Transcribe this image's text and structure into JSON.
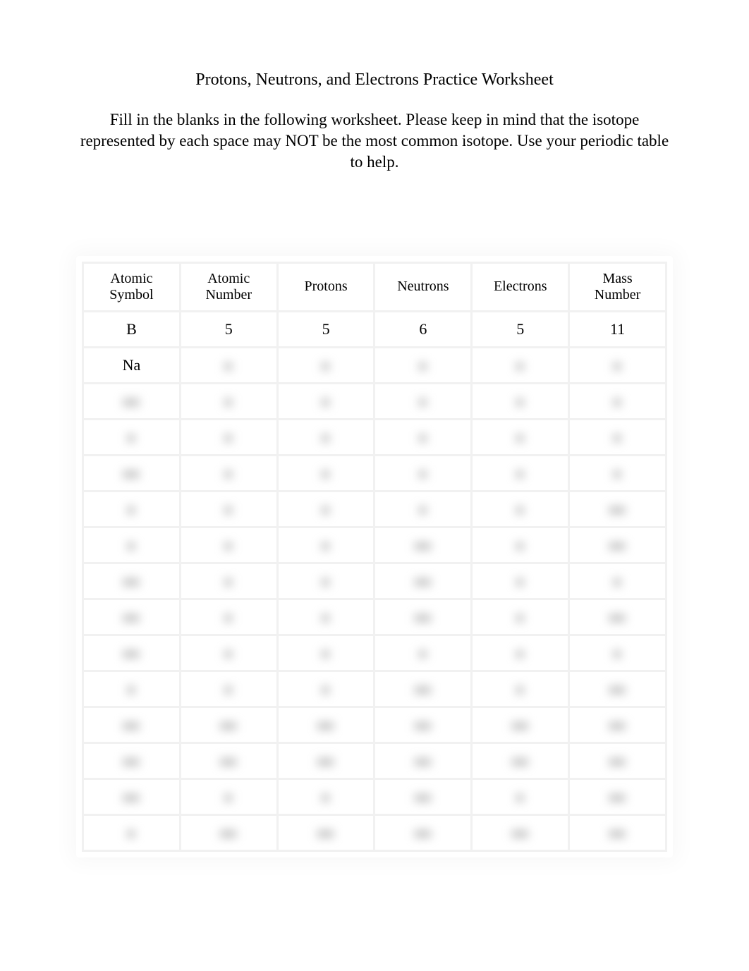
{
  "title": "Protons, Neutrons, and Electrons Practice Worksheet",
  "instructions": "Fill in the blanks in the following worksheet. Please keep in mind that the isotope represented by each space may NOT be the most common isotope. Use your periodic table to help​.",
  "headers": {
    "col0": "Atomic\nSymbol",
    "col1": "Atomic\nNumber",
    "col2": "Protons",
    "col3": "Neutrons",
    "col4": "Electrons",
    "col5": "Mass\nNumber"
  },
  "rows": [
    {
      "c0": {
        "text": "B",
        "blur": false
      },
      "c1": {
        "text": "5",
        "blur": false
      },
      "c2": {
        "text": "5",
        "blur": false
      },
      "c3": {
        "text": "6",
        "blur": false
      },
      "c4": {
        "text": "5",
        "blur": false
      },
      "c5": {
        "text": "11",
        "blur": false
      }
    },
    {
      "c0": {
        "text": "Na",
        "blur": false
      },
      "c1": {
        "text": "■",
        "blur": true
      },
      "c2": {
        "text": "■",
        "blur": true
      },
      "c3": {
        "text": "■",
        "blur": true
      },
      "c4": {
        "text": "■",
        "blur": true
      },
      "c5": {
        "text": "■",
        "blur": true
      }
    },
    {
      "c0": {
        "text": "■■",
        "blur": true
      },
      "c1": {
        "text": "■",
        "blur": true
      },
      "c2": {
        "text": "■",
        "blur": true
      },
      "c3": {
        "text": "■",
        "blur": true
      },
      "c4": {
        "text": "■",
        "blur": true
      },
      "c5": {
        "text": "■",
        "blur": true
      }
    },
    {
      "c0": {
        "text": "■",
        "blur": true
      },
      "c1": {
        "text": "■",
        "blur": true
      },
      "c2": {
        "text": "■",
        "blur": true
      },
      "c3": {
        "text": "■",
        "blur": true
      },
      "c4": {
        "text": "■",
        "blur": true
      },
      "c5": {
        "text": "■",
        "blur": true
      }
    },
    {
      "c0": {
        "text": "■■",
        "blur": true
      },
      "c1": {
        "text": "■",
        "blur": true
      },
      "c2": {
        "text": "■",
        "blur": true
      },
      "c3": {
        "text": "■",
        "blur": true
      },
      "c4": {
        "text": "■",
        "blur": true
      },
      "c5": {
        "text": "■",
        "blur": true
      }
    },
    {
      "c0": {
        "text": "■",
        "blur": true
      },
      "c1": {
        "text": "■",
        "blur": true
      },
      "c2": {
        "text": "■",
        "blur": true
      },
      "c3": {
        "text": "■",
        "blur": true
      },
      "c4": {
        "text": "■",
        "blur": true
      },
      "c5": {
        "text": "■■",
        "blur": true
      }
    },
    {
      "c0": {
        "text": "■",
        "blur": true
      },
      "c1": {
        "text": "■",
        "blur": true
      },
      "c2": {
        "text": "■",
        "blur": true
      },
      "c3": {
        "text": "■■",
        "blur": true
      },
      "c4": {
        "text": "■",
        "blur": true
      },
      "c5": {
        "text": "■■",
        "blur": true
      }
    },
    {
      "c0": {
        "text": "■■",
        "blur": true
      },
      "c1": {
        "text": "■",
        "blur": true
      },
      "c2": {
        "text": "■",
        "blur": true
      },
      "c3": {
        "text": "■■",
        "blur": true
      },
      "c4": {
        "text": "■",
        "blur": true
      },
      "c5": {
        "text": "■",
        "blur": true
      }
    },
    {
      "c0": {
        "text": "■■",
        "blur": true
      },
      "c1": {
        "text": "■",
        "blur": true
      },
      "c2": {
        "text": "■",
        "blur": true
      },
      "c3": {
        "text": "■■",
        "blur": true
      },
      "c4": {
        "text": "■",
        "blur": true
      },
      "c5": {
        "text": "■■",
        "blur": true
      }
    },
    {
      "c0": {
        "text": "■■",
        "blur": true
      },
      "c1": {
        "text": "■",
        "blur": true
      },
      "c2": {
        "text": "■",
        "blur": true
      },
      "c3": {
        "text": "■",
        "blur": true
      },
      "c4": {
        "text": "■",
        "blur": true
      },
      "c5": {
        "text": "■",
        "blur": true
      }
    },
    {
      "c0": {
        "text": "■",
        "blur": true
      },
      "c1": {
        "text": "■",
        "blur": true
      },
      "c2": {
        "text": "■",
        "blur": true
      },
      "c3": {
        "text": "■■",
        "blur": true
      },
      "c4": {
        "text": "■",
        "blur": true
      },
      "c5": {
        "text": "■■",
        "blur": true
      }
    },
    {
      "c0": {
        "text": "■■",
        "blur": true
      },
      "c1": {
        "text": "■■",
        "blur": true
      },
      "c2": {
        "text": "■■",
        "blur": true
      },
      "c3": {
        "text": "■■",
        "blur": true
      },
      "c4": {
        "text": "■■",
        "blur": true
      },
      "c5": {
        "text": "■■",
        "blur": true
      }
    },
    {
      "c0": {
        "text": "■■",
        "blur": true
      },
      "c1": {
        "text": "■■",
        "blur": true
      },
      "c2": {
        "text": "■■",
        "blur": true
      },
      "c3": {
        "text": "■■",
        "blur": true
      },
      "c4": {
        "text": "■■",
        "blur": true
      },
      "c5": {
        "text": "■■",
        "blur": true
      }
    },
    {
      "c0": {
        "text": "■■",
        "blur": true
      },
      "c1": {
        "text": "■",
        "blur": true
      },
      "c2": {
        "text": "■",
        "blur": true
      },
      "c3": {
        "text": "■■",
        "blur": true
      },
      "c4": {
        "text": "■",
        "blur": true
      },
      "c5": {
        "text": "■■",
        "blur": true
      }
    },
    {
      "c0": {
        "text": "■",
        "blur": true
      },
      "c1": {
        "text": "■■",
        "blur": true
      },
      "c2": {
        "text": "■■",
        "blur": true
      },
      "c3": {
        "text": "■■",
        "blur": true
      },
      "c4": {
        "text": "■■",
        "blur": true
      },
      "c5": {
        "text": "■■",
        "blur": true
      }
    }
  ]
}
